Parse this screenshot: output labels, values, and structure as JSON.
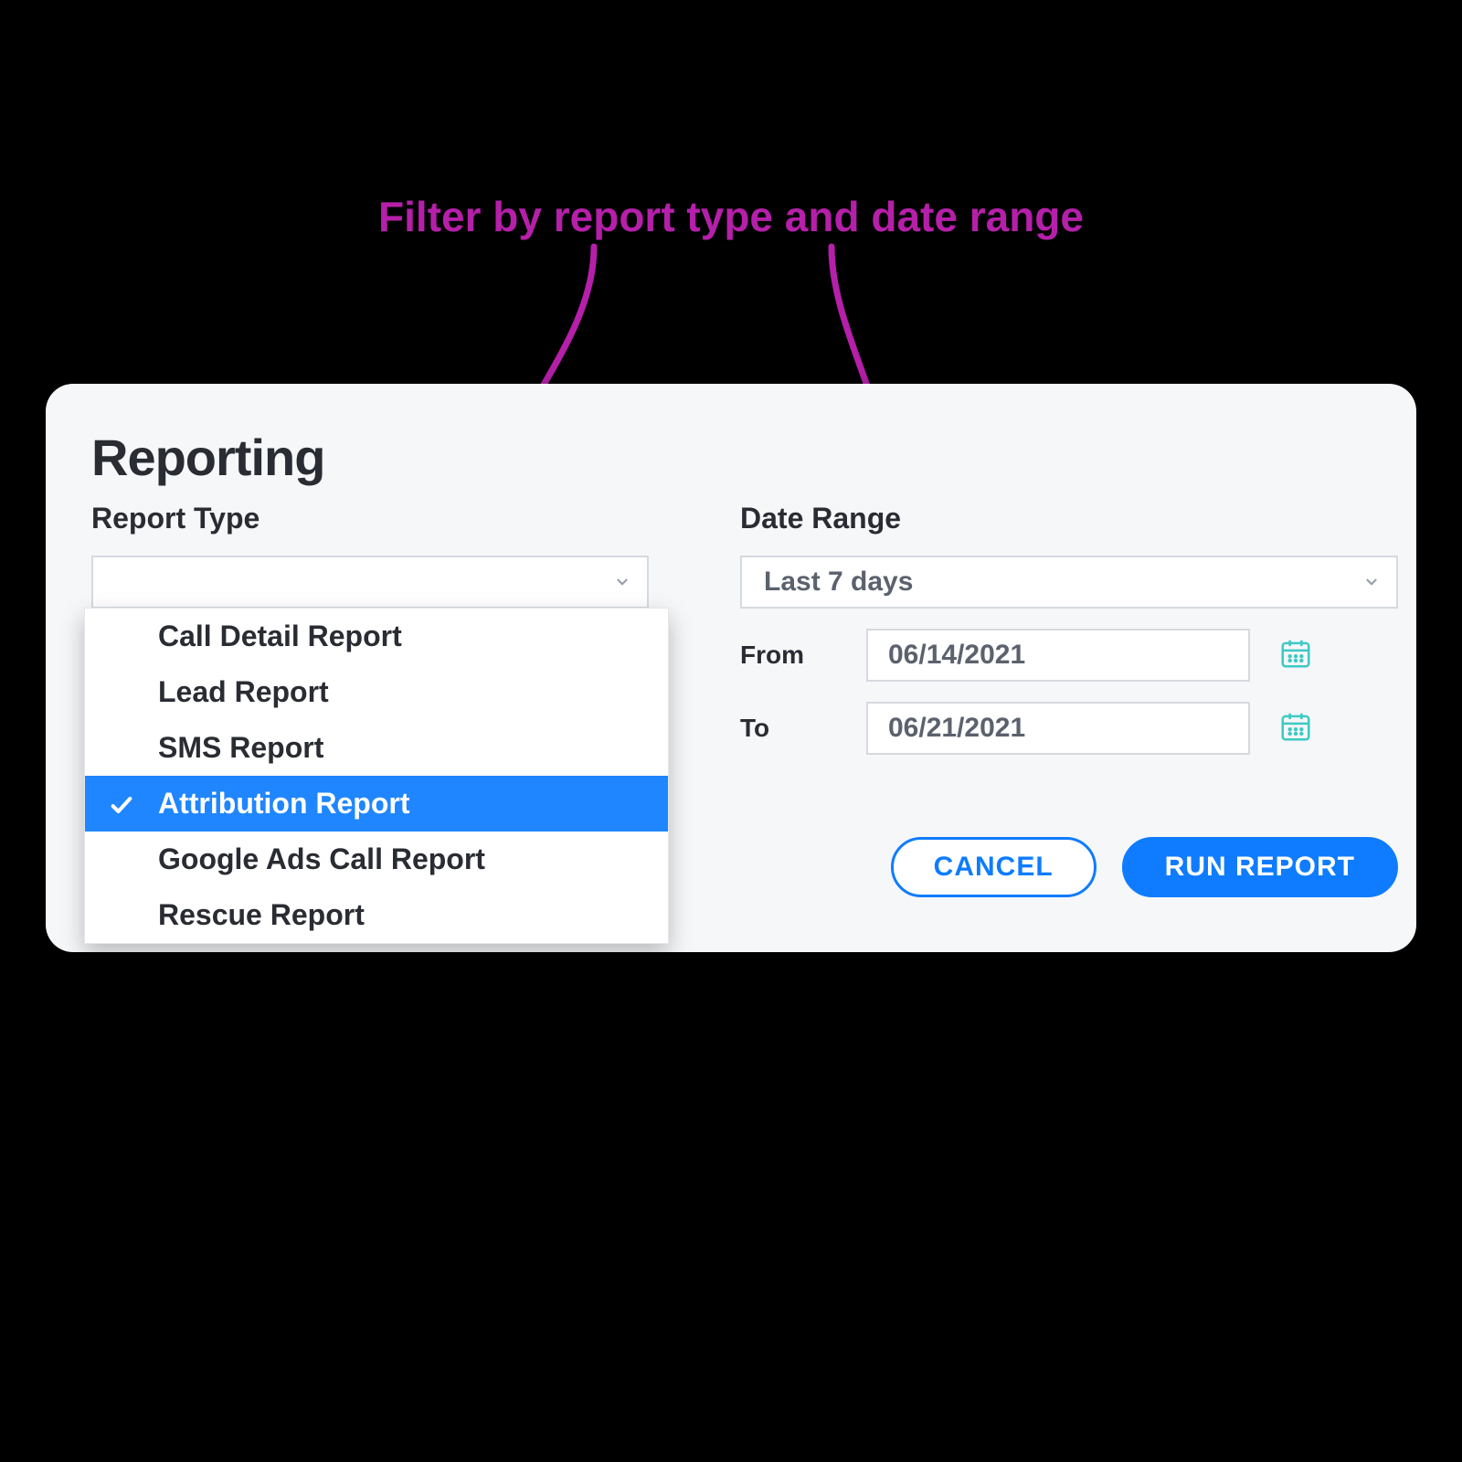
{
  "annotation": "Filter by report type and date range",
  "panel": {
    "title": "Reporting",
    "report_type": {
      "label": "Report Type",
      "value": "",
      "options": [
        {
          "label": "Call Detail Report",
          "selected": false
        },
        {
          "label": "Lead Report",
          "selected": false
        },
        {
          "label": "SMS Report",
          "selected": false
        },
        {
          "label": "Attribution Report",
          "selected": true
        },
        {
          "label": "Google Ads Call Report",
          "selected": false
        },
        {
          "label": "Rescue Report",
          "selected": false
        }
      ]
    },
    "date_range": {
      "label": "Date Range",
      "preset_value": "Last 7 days",
      "from_label": "From",
      "from_value": "06/14/2021",
      "to_label": "To",
      "to_value": "06/21/2021"
    },
    "actions": {
      "cancel": "CANCEL",
      "run": "RUN REPORT"
    }
  },
  "colors": {
    "annotation": "#b51fa9",
    "primary": "#0f7cff",
    "teal": "#3ec9c4"
  }
}
